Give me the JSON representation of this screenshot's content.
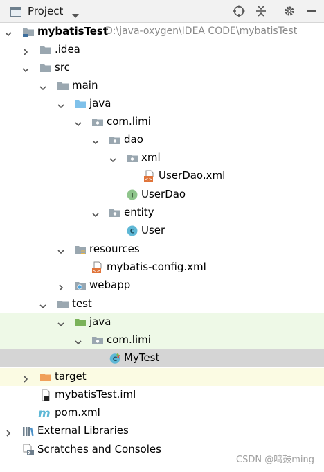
{
  "toolbar": {
    "title": "Project",
    "icons": [
      "project-icon",
      "dropdown-icon",
      "locate-icon",
      "collapse-all-icon",
      "settings-icon",
      "minimize-icon"
    ]
  },
  "tree": {
    "root_name": "mybatisTest",
    "root_path": "D:\\java-oxygen\\IDEA CODE\\mybatisTest",
    "idea": ".idea",
    "src": "src",
    "main": "main",
    "main_java": "java",
    "main_pkg": "com.limi",
    "dao": "dao",
    "xml": "xml",
    "userdao_xml": "UserDao.xml",
    "userdao": "UserDao",
    "entity": "entity",
    "user": "User",
    "resources": "resources",
    "mybatis_config": "mybatis-config.xml",
    "webapp": "webapp",
    "test": "test",
    "test_java": "java",
    "test_pkg": "com.limi",
    "mytest": "MyTest",
    "target": "target",
    "iml": "mybatisTest.iml",
    "pom": "pom.xml",
    "external_libraries": "External Libraries",
    "scratches": "Scratches and Consoles"
  },
  "watermark": "CSDN @鸣鼓ming",
  "colors": {
    "folder_gray": "#9aa7b0",
    "source_blue": "#7fc1ea",
    "test_green": "#7bb35a",
    "excluded_orange": "#f0a05a",
    "interface_green": "#8fc58c",
    "class_cyan": "#5fb8d6",
    "selected_row": "#d5d5d5",
    "test_row": "#eef9e7",
    "excluded_row": "#fbfbe3"
  }
}
